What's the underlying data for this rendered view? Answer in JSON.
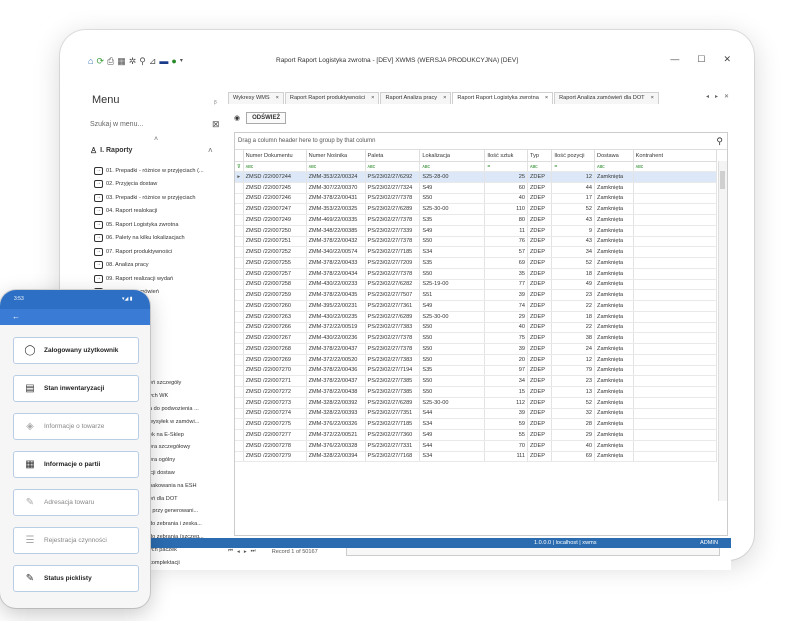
{
  "window": {
    "title": "Raport Raport Logistyka zwrotna - [DEV] XWMS (WERSJA PRODUKCYJNA) [DEV]",
    "minimize": "—",
    "maximize": "☐",
    "close": "✕"
  },
  "menu": {
    "title": "Menu",
    "pin": "ᵦ",
    "search_placeholder": "Szukaj w menu...",
    "group_label": "I. Raporty",
    "items": [
      "01. Prepadki - różnice w przyjęciach (...",
      "02. Przyjęcia dostaw",
      "03. Prepadki - różnice w przyjęciach",
      "04. Raport realokacji",
      "05. Raport Logistyka zwrotna",
      "06. Palety na kilku lokalizacjach",
      "07. Raport produktywności",
      "08. Analiza pracy",
      "09. Raport realizacji wydań",
      "10. Raport zamówień"
    ],
    "items_partial": [
      "eń szczegóły",
      "ych WK",
      "a do podwozienia ...",
      "wysyłek w zamówi...",
      "ek na E-Sklep",
      "era szczegółowy",
      "era ogólny",
      "icji dostaw",
      "pakowania na ESH",
      "eń dla DOT",
      "- przy generowani...",
      "do zebrania i zeska...",
      "do zebrania (szczeg...",
      "ych paczek",
      "komplektacji",
      "ań raportów",
      "realokacji"
    ]
  },
  "tabs": [
    {
      "label": "Wykresy WMS",
      "close": "×"
    },
    {
      "label": "Raport Raport produktywności",
      "close": "×"
    },
    {
      "label": "Raport Analiza pracy",
      "close": "×"
    },
    {
      "label": "Raport Raport Logistyka zwrotna",
      "close": "×"
    },
    {
      "label": "Raport Analiza zamówień dla DOT",
      "close": "×"
    }
  ],
  "toolbar": {
    "refresh_label": "ODŚWIEŻ"
  },
  "grid": {
    "group_hint": "Drag a column header here to group by that column",
    "columns": [
      "Numer Dokumentu",
      "Numer Nośnika",
      "Paleta",
      "Lokalizacja",
      "Ilość sztuk",
      "Typ",
      "Ilość pozycji",
      "Dostawa",
      "Kontrahent"
    ],
    "filter_row": [
      "ᴀʙᴄ",
      "ᴀʙᴄ",
      "ᴀʙᴄ",
      "ᴀʙᴄ",
      "=",
      "ᴀʙᴄ",
      "=",
      "ᴀʙᴄ",
      "ᴀʙᴄ"
    ],
    "rows": [
      [
        "ZMSD /22/007244",
        "ZMM-353/22/00324",
        "PS/23/02/27/6292",
        "S25-28-00",
        "25",
        "ZDEP",
        "12",
        "Zamknięta",
        ""
      ],
      [
        "ZMSD /22/007245",
        "ZMM-307/22/00370",
        "PS/23/02/27/7324",
        "S49",
        "60",
        "ZDEP",
        "44",
        "Zamknięta",
        ""
      ],
      [
        "ZMSD /22/007246",
        "ZMM-378/22/00431",
        "PS/23/02/27/7378",
        "S50",
        "40",
        "ZDEP",
        "17",
        "Zamknięta",
        ""
      ],
      [
        "ZMSD /22/007247",
        "ZMM-353/22/00325",
        "PS/23/02/27/6289",
        "S25-30-00",
        "110",
        "ZDEP",
        "52",
        "Zamknięta",
        ""
      ],
      [
        "ZMSD /22/007249",
        "ZMM-469/22/00335",
        "PS/23/02/27/7378",
        "S35",
        "80",
        "ZDEP",
        "43",
        "Zamknięta",
        ""
      ],
      [
        "ZMSD /22/007250",
        "ZMM-348/22/00385",
        "PS/23/02/27/7339",
        "S49",
        "11",
        "ZDEP",
        "9",
        "Zamknięta",
        ""
      ],
      [
        "ZMSD /22/007251",
        "ZMM-378/22/00432",
        "PS/23/02/27/7378",
        "S50",
        "76",
        "ZDEP",
        "43",
        "Zamknięta",
        ""
      ],
      [
        "ZMSD /22/007252",
        "ZMM-340/22/00574",
        "PS/23/02/27/7185",
        "S34",
        "57",
        "ZDEP",
        "34",
        "Zamknięta",
        ""
      ],
      [
        "ZMSD /22/007255",
        "ZMM-378/22/00433",
        "PS/23/02/27/7209",
        "S35",
        "69",
        "ZDEP",
        "52",
        "Zamknięta",
        ""
      ],
      [
        "ZMSD /22/007257",
        "ZMM-378/22/00434",
        "PS/23/02/27/7378",
        "S50",
        "35",
        "ZDEP",
        "18",
        "Zamknięta",
        ""
      ],
      [
        "ZMSD /22/007258",
        "ZMM-430/22/00233",
        "PS/23/02/27/6282",
        "S25-19-00",
        "77",
        "ZDEP",
        "49",
        "Zamknięta",
        ""
      ],
      [
        "ZMSD /22/007259",
        "ZMM-378/22/00435",
        "PS/23/02/27/7507",
        "S51",
        "39",
        "ZDEP",
        "23",
        "Zamknięta",
        ""
      ],
      [
        "ZMSD /22/007260",
        "ZMM-395/22/00231",
        "PS/23/02/27/7361",
        "S49",
        "74",
        "ZDEP",
        "22",
        "Zamknięta",
        ""
      ],
      [
        "ZMSD /22/007263",
        "ZMM-430/22/00235",
        "PS/23/02/27/6289",
        "S25-30-00",
        "29",
        "ZDEP",
        "18",
        "Zamknięta",
        ""
      ],
      [
        "ZMSD /22/007266",
        "ZMM-372/22/00519",
        "PS/23/02/27/7383",
        "S50",
        "40",
        "ZDEP",
        "22",
        "Zamknięta",
        ""
      ],
      [
        "ZMSD /22/007267",
        "ZMM-430/22/00236",
        "PS/23/02/27/7378",
        "S50",
        "75",
        "ZDEP",
        "38",
        "Zamknięta",
        ""
      ],
      [
        "ZMSD /22/007268",
        "ZMM-378/22/00437",
        "PS/23/02/27/7378",
        "S50",
        "39",
        "ZDEP",
        "24",
        "Zamknięta",
        ""
      ],
      [
        "ZMSD /22/007269",
        "ZMM-372/22/00520",
        "PS/23/02/27/7383",
        "S50",
        "20",
        "ZDEP",
        "12",
        "Zamknięta",
        ""
      ],
      [
        "ZMSD /22/007270",
        "ZMM-378/22/00436",
        "PS/23/02/27/7194",
        "S35",
        "97",
        "ZDEP",
        "79",
        "Zamknięta",
        ""
      ],
      [
        "ZMSD /22/007271",
        "ZMM-378/22/00437",
        "PS/23/02/27/7385",
        "S50",
        "34",
        "ZDEP",
        "23",
        "Zamknięta",
        ""
      ],
      [
        "ZMSD /22/007272",
        "ZMM-378/22/00438",
        "PS/23/02/27/7385",
        "S50",
        "15",
        "ZDEP",
        "13",
        "Zamknięta",
        ""
      ],
      [
        "ZMSD /22/007273",
        "ZMM-328/22/00392",
        "PS/23/02/27/6289",
        "S25-30-00",
        "112",
        "ZDEP",
        "52",
        "Zamknięta",
        ""
      ],
      [
        "ZMSD /22/007274",
        "ZMM-328/22/00393",
        "PS/23/02/27/7351",
        "S44",
        "39",
        "ZDEP",
        "32",
        "Zamknięta",
        ""
      ],
      [
        "ZMSD /22/007275",
        "ZMM-376/22/00326",
        "PS/23/02/27/7185",
        "S34",
        "59",
        "ZDEP",
        "28",
        "Zamknięta",
        ""
      ],
      [
        "ZMSD /22/007277",
        "ZMM-372/22/00521",
        "PS/23/02/27/7360",
        "S49",
        "55",
        "ZDEP",
        "29",
        "Zamknięta",
        ""
      ],
      [
        "ZMSD /22/007278",
        "ZMM-376/22/00328",
        "PS/23/02/27/7331",
        "S44",
        "70",
        "ZDEP",
        "40",
        "Zamknięta",
        ""
      ],
      [
        "ZMSD /22/007279",
        "ZMM-328/22/00394",
        "PS/23/02/27/7168",
        "S34",
        "111",
        "ZDEP",
        "69",
        "Zamknięta",
        ""
      ]
    ],
    "record_info": "Record 1 of 50167"
  },
  "statusbar": {
    "version": "1.0.0.0 | localhost | xwms",
    "user": "ADMIN"
  },
  "phone": {
    "time": "3:53",
    "status_icons": "▾◢ ▮",
    "back": "←",
    "buttons": [
      {
        "label": "Zalogowany użytkownik",
        "icon": "user-icon",
        "glyph": "◯",
        "enabled": true
      },
      {
        "label": "Stan inwentaryzacji",
        "icon": "inventory-icon",
        "glyph": "▤",
        "enabled": true
      },
      {
        "label": "Informacje o towarze",
        "icon": "box-icon",
        "glyph": "◈",
        "enabled": false
      },
      {
        "label": "Informacje o partii",
        "icon": "batch-icon",
        "glyph": "▦",
        "enabled": true
      },
      {
        "label": "Adresacja towaru",
        "icon": "edit-icon",
        "glyph": "✎",
        "enabled": false
      },
      {
        "label": "Rejestracja czynności",
        "icon": "clipboard-icon",
        "glyph": "☰",
        "enabled": false
      },
      {
        "label": "Status picklisty",
        "icon": "edit-icon",
        "glyph": "✎",
        "enabled": true
      }
    ]
  },
  "colors": {
    "accent": "#2d6fc4",
    "statusbar": "#2b6cb0",
    "selected_row": "#dce8f7"
  }
}
